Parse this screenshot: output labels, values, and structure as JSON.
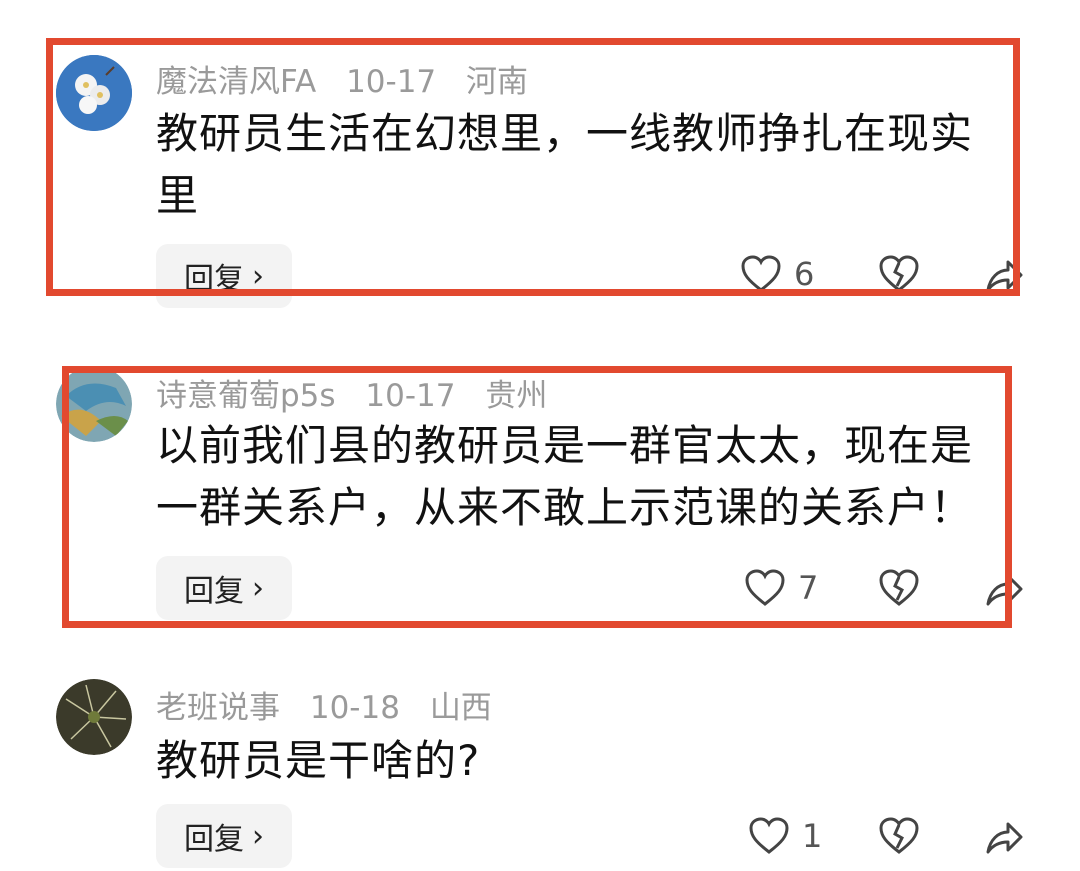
{
  "comments": [
    {
      "username": "魔法清风FA",
      "date": "10-17",
      "location": "河南",
      "text": "教研员生活在幻想里，一线教师挣扎在现实里",
      "reply_label": "回复",
      "likes": "6"
    },
    {
      "username": "诗意葡萄p5s",
      "date": "10-17",
      "location": "贵州",
      "text": "以前我们县的教研员是一群官太太，现在是一群关系户，从来不敢上示范课的关系户！",
      "reply_label": "回复",
      "likes": "7"
    },
    {
      "username": "老班说事",
      "date": "10-18",
      "location": "山西",
      "text": "教研员是干啥的?",
      "reply_label": "回复",
      "likes": "1"
    }
  ],
  "icons": {
    "like": "heart-icon",
    "dislike": "broken-heart-icon",
    "share": "share-icon"
  },
  "colors": {
    "highlight": "#e2492f",
    "meta_text": "#9a9a9a",
    "body_text": "#111111"
  }
}
